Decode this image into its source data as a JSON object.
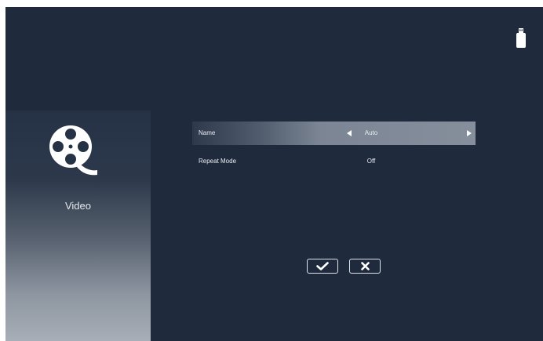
{
  "sidebar": {
    "title": "Video",
    "icon": "film-reel-icon"
  },
  "status": {
    "usb_icon": "usb-drive-icon"
  },
  "settings": [
    {
      "label": "Name",
      "value": "Auto",
      "selected": true
    },
    {
      "label": "Repeat Mode",
      "value": "Off",
      "selected": false
    }
  ],
  "buttons": {
    "confirm_icon": "checkmark-icon",
    "cancel_icon": "close-icon"
  },
  "colors": {
    "background": "#1f2b3d",
    "text": "#e8ecf1"
  }
}
